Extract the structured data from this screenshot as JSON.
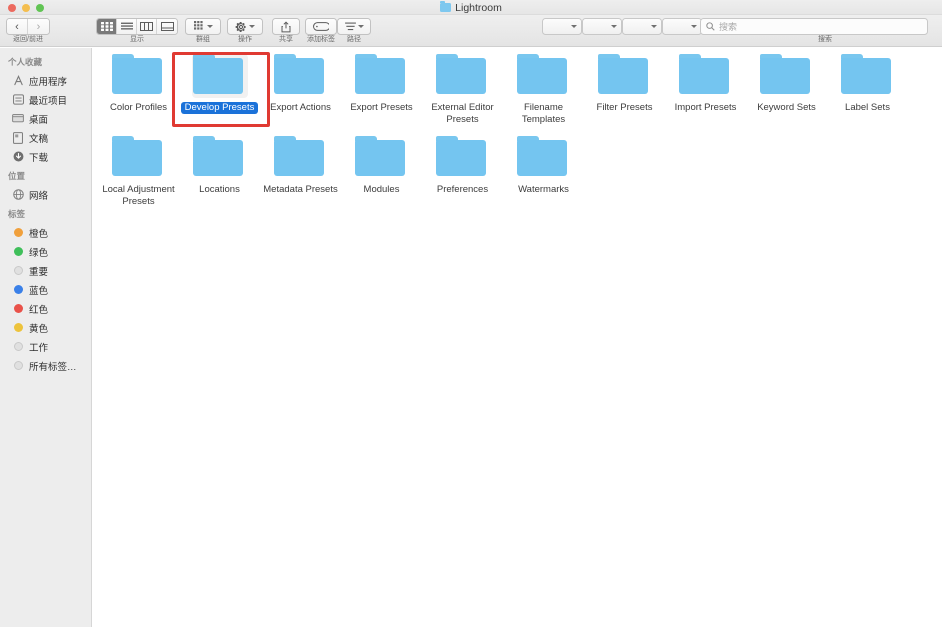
{
  "window": {
    "title": "Lightroom",
    "title_icon": "folder-icon",
    "traffic_lights": [
      "close-button",
      "minimize-button",
      "zoom-button"
    ]
  },
  "toolbar": {
    "nav": {
      "label": "返回/前进",
      "back": "‹",
      "forward": "›"
    },
    "view": {
      "label": "显示",
      "modes": [
        "icon-view",
        "list-view",
        "column-view",
        "gallery-view"
      ],
      "selected_index": 0
    },
    "group": {
      "label": "群组",
      "icon": "grid-icon"
    },
    "action": {
      "label": "操作",
      "icon": "gear-icon"
    },
    "share": {
      "label": "共享",
      "icon": "share-icon"
    },
    "tag": {
      "label": "添加标签",
      "icon": "tag-icon"
    },
    "path": {
      "label": "路径",
      "icon": "path-icon"
    },
    "search": {
      "label": "搜索",
      "placeholder": "搜索",
      "value": "",
      "icon": "search-icon"
    },
    "filters": [
      "",
      "",
      "",
      ""
    ]
  },
  "sidebar": {
    "sections": [
      {
        "header": "个人收藏",
        "items": [
          {
            "label": "应用程序",
            "icon": "applications-icon"
          },
          {
            "label": "最近项目",
            "icon": "recents-icon"
          },
          {
            "label": "桌面",
            "icon": "desktop-icon"
          },
          {
            "label": "文稿",
            "icon": "documents-icon"
          },
          {
            "label": "下载",
            "icon": "downloads-icon"
          }
        ]
      },
      {
        "header": "位置",
        "items": [
          {
            "label": "网络",
            "icon": "network-icon"
          }
        ]
      },
      {
        "header": "标签",
        "items": [
          {
            "label": "橙色",
            "icon": "tag-dot",
            "color": "#f0a03c"
          },
          {
            "label": "绿色",
            "icon": "tag-dot",
            "color": "#3fbf5a"
          },
          {
            "label": "重要",
            "icon": "tag-dot-hollow",
            "color": "#e2e2e2"
          },
          {
            "label": "蓝色",
            "icon": "tag-dot",
            "color": "#3a80e8"
          },
          {
            "label": "红色",
            "icon": "tag-dot",
            "color": "#e9524a"
          },
          {
            "label": "黄色",
            "icon": "tag-dot",
            "color": "#edc33c"
          },
          {
            "label": "工作",
            "icon": "tag-dot-hollow",
            "color": "#e2e2e2"
          },
          {
            "label": "所有标签…",
            "icon": "tag-dot-hollow",
            "color": "#dcdcdc"
          }
        ]
      }
    ]
  },
  "content": {
    "view_mode": "icon-view",
    "folder_color": "#74c5f0",
    "selection_color": "#1b72d9",
    "rows": [
      {
        "items": [
          {
            "label": "Color Profiles",
            "selected": false
          },
          {
            "label": "Develop Presets",
            "selected": true
          },
          {
            "label": "Export Actions",
            "selected": false
          },
          {
            "label": "Export Presets",
            "selected": false
          },
          {
            "label": "External Editor Presets",
            "selected": false
          },
          {
            "label": "Filename Templates",
            "selected": false
          },
          {
            "label": "Filter Presets",
            "selected": false
          },
          {
            "label": "Import Presets",
            "selected": false
          },
          {
            "label": "Keyword Sets",
            "selected": false
          },
          {
            "label": "Label Sets",
            "selected": false
          }
        ]
      },
      {
        "items": [
          {
            "label": "Local Adjustment Presets",
            "selected": false
          },
          {
            "label": "Locations",
            "selected": false
          },
          {
            "label": "Metadata Presets",
            "selected": false
          },
          {
            "label": "Modules",
            "selected": false
          },
          {
            "label": "Preferences",
            "selected": false
          },
          {
            "label": "Watermarks",
            "selected": false
          }
        ]
      }
    ]
  },
  "annotation": {
    "color": "#e03a32",
    "target": "Develop Presets"
  }
}
